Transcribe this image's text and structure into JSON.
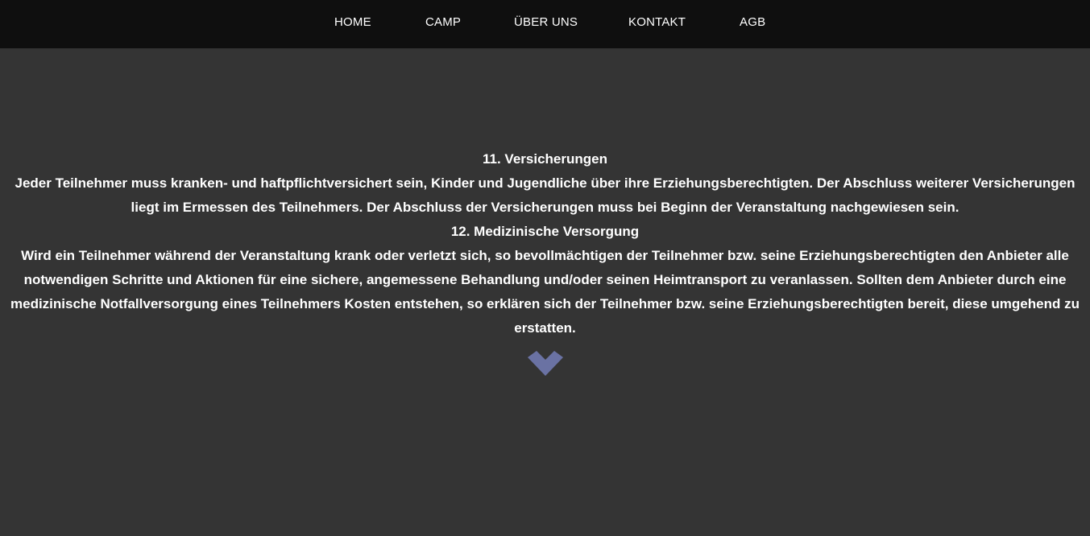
{
  "nav": {
    "items": [
      {
        "label": "HOME"
      },
      {
        "label": "CAMP"
      },
      {
        "label": "ÜBER UNS"
      },
      {
        "label": "KONTAKT"
      },
      {
        "label": "AGB"
      }
    ]
  },
  "content": {
    "section11_title": "11. Versicherungen",
    "section11_text": "Jeder Teilnehmer muss kranken- und haftpflichtversichert sein, Kinder und Jugendliche über ihre Erziehungsberechtigten. Der Abschluss weiterer Versicherungen liegt im Ermessen des Teilnehmers. Der Abschluss der Versicherungen muss bei Beginn der Veranstaltung nachgewiesen sein.",
    "section12_title": "12. Medizinische Versorgung",
    "section12_text": "Wird ein Teilnehmer während der Veranstaltung krank oder verletzt sich, so bevollmächtigen der Teilnehmer bzw. seine Erziehungsberechtigten den Anbieter alle notwendigen Schritte und Aktionen für eine sichere, angemessene Behandlung und/oder seinen Heimtransport zu veranlassen. Sollten dem Anbieter durch eine medizinische Notfallversorgung eines Teilnehmers Kosten entstehen, so erklären sich der Teilnehmer bzw. seine Erziehungsberechtigten bereit, diese umgehend zu erstatten."
  },
  "scroll_icon": {
    "name": "chevron-down-icon",
    "color": "#6a72a3"
  },
  "colors": {
    "nav_background": "#0f0f0f",
    "page_background": "#343434",
    "text": "#ffffff"
  }
}
